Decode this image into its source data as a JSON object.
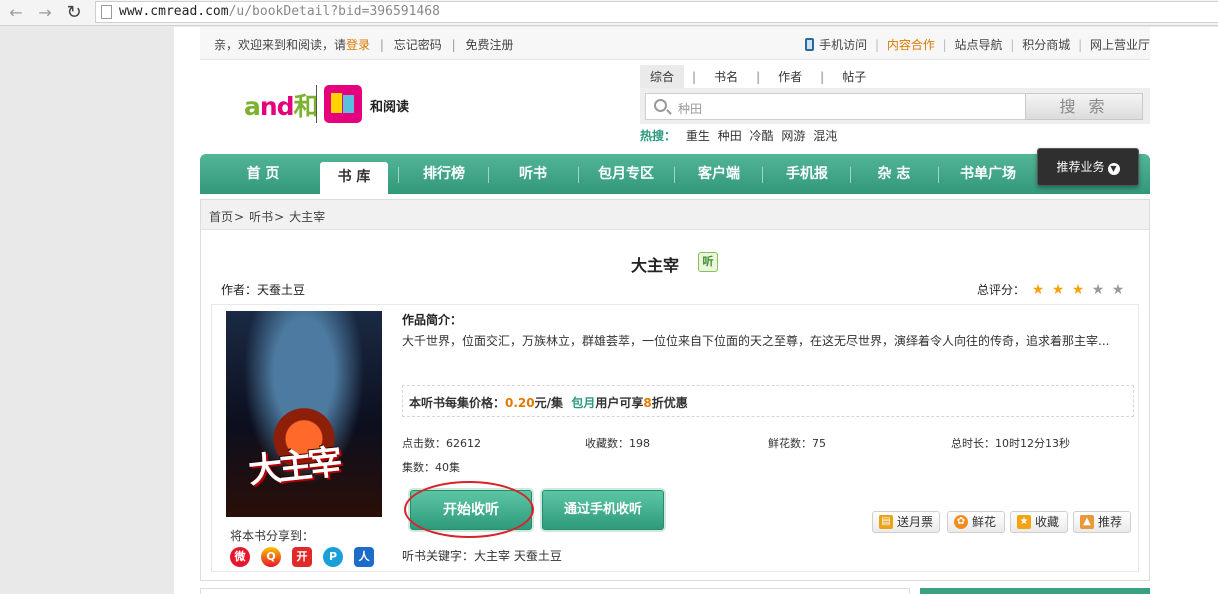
{
  "browser": {
    "url_host": "www.cmread.com",
    "url_path": "/u/bookDetail?bid=396591468"
  },
  "topbar": {
    "welcome": "亲，欢迎来到和阅读，请",
    "login": "登录",
    "forgot_password": "忘记密码",
    "register": "免费注册",
    "links": [
      {
        "label": "手机访问",
        "highlight": false
      },
      {
        "label": "内容合作",
        "highlight": true
      },
      {
        "label": "站点导航",
        "highlight": false
      },
      {
        "label": "积分商城",
        "highlight": false
      },
      {
        "label": "网上营业厅",
        "highlight": false
      }
    ]
  },
  "logo": {
    "brand_en_a": "a",
    "brand_en_nd": "nd",
    "brand_cn": "和",
    "product_name": "和阅读"
  },
  "search": {
    "tabs": [
      "综合",
      "书名",
      "作者",
      "帖子"
    ],
    "active_tab": 0,
    "placeholder": "种田",
    "button_label": "搜 索",
    "hot_label": "热搜：",
    "hot_items": [
      "重生",
      "种田",
      "冷酷",
      "网游",
      "混沌"
    ]
  },
  "mainnav": {
    "items": [
      "首 页",
      "书 库",
      "排行榜",
      "听书",
      "包月专区",
      "客户端",
      "手机报",
      "杂 志",
      "书单广场"
    ],
    "active": 1,
    "recommend": "推荐业务"
  },
  "breadcrumb": [
    "首页",
    "听书",
    "大主宰"
  ],
  "book": {
    "title": "大主宰",
    "listen_icon": "听",
    "author_label": "作者：",
    "author": "天蚕土豆",
    "rating_label": "总评分：",
    "rating": 3,
    "rating_max": 5,
    "cover_title": "大主宰",
    "intro_label": "作品简介：",
    "intro": "大千世界，位面交汇，万族林立，群雄荟萃，一位位来自下位面的天之至尊，在这无尽世界，演绎着令人向往的传奇，追求着那主宰...",
    "price_prefix": "本听书每集价格：",
    "price": "0.20",
    "price_unit": "元/集",
    "monthly_label": "包月",
    "monthly_mid": "用户可享",
    "discount": "8",
    "discount_suffix": "折优惠",
    "stats": [
      {
        "label": "点击数：",
        "value": "62612"
      },
      {
        "label": "收藏数：",
        "value": "198"
      },
      {
        "label": "鲜花数：",
        "value": "75"
      },
      {
        "label": "总时长：",
        "value": "10时12分13秒"
      }
    ],
    "episodes_label": "集数：",
    "episodes": "40集",
    "btn_start": "开始收听",
    "btn_phone": "通过手机收听",
    "actions": [
      "送月票",
      "鲜花",
      "收藏",
      "推荐"
    ],
    "share_label": "将本书分享到：",
    "share_icons": [
      {
        "name": "weibo",
        "glyph": "微"
      },
      {
        "name": "qzone",
        "glyph": "Q"
      },
      {
        "name": "kaixin",
        "glyph": "开"
      },
      {
        "name": "pengyou",
        "glyph": "P"
      },
      {
        "name": "renren",
        "glyph": "人"
      }
    ],
    "keywords_label": "听书关键字：",
    "keywords": "大主宰 天蚕土豆"
  },
  "colors": {
    "nav_green": "#3aa283",
    "accent_orange": "#e07a00",
    "accent_green": "#2b9a7f",
    "annotation_red": "#d8232a"
  }
}
